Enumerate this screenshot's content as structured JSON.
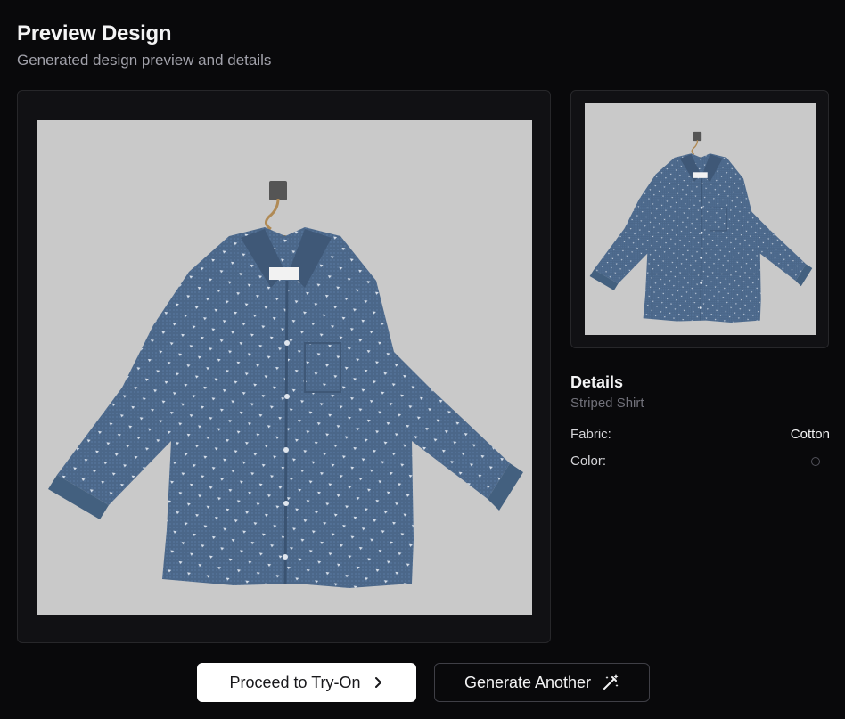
{
  "header": {
    "title": "Preview Design",
    "subtitle": "Generated design preview and details"
  },
  "preview": {
    "main_image_icon": "shirt-image",
    "thumbnail_icon": "shirt-image",
    "image_background": "#c9c9c9",
    "shirt_color": "#4a6585"
  },
  "details": {
    "heading": "Details",
    "name": "Striped Shirt",
    "fabric_label": "Fabric:",
    "fabric_value": "Cotton",
    "color_label": "Color:"
  },
  "actions": {
    "proceed_label": "Proceed to Try-On",
    "proceed_icon": "chevron-right-icon",
    "generate_label": "Generate Another",
    "generate_icon": "magic-wand-icon"
  }
}
